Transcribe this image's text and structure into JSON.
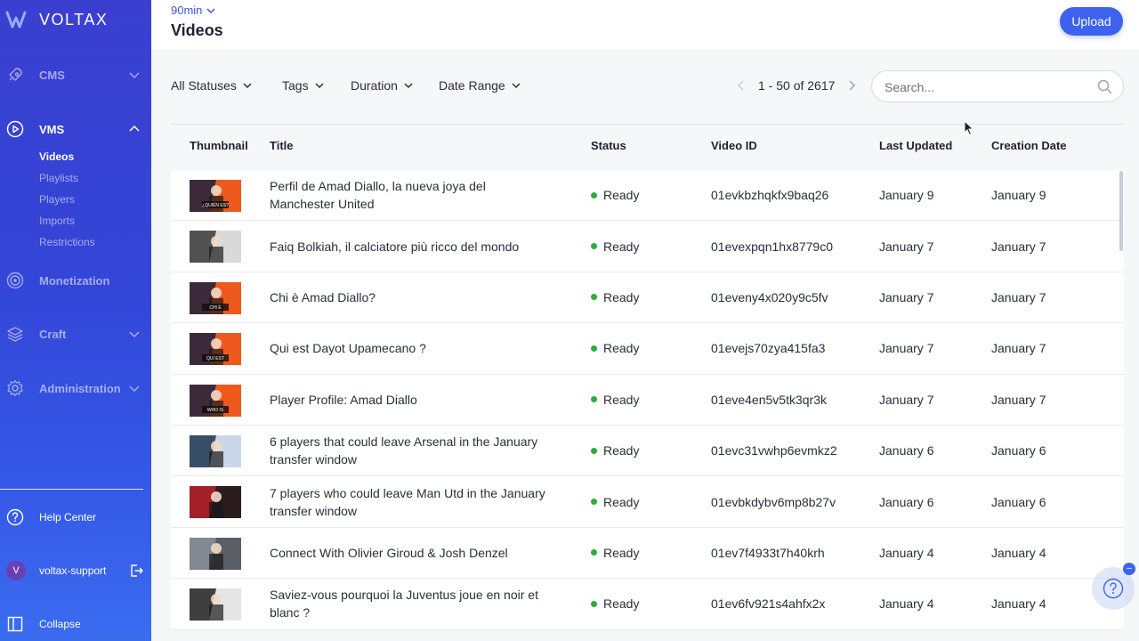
{
  "brand": {
    "name": "VOLTAX"
  },
  "sidebar": {
    "nav": [
      {
        "label": "CMS",
        "icon": "rocket-icon"
      },
      {
        "label": "VMS",
        "icon": "play-circle-icon"
      },
      {
        "label": "Monetization",
        "icon": "target-icon"
      },
      {
        "label": "Craft",
        "icon": "layers-icon"
      },
      {
        "label": "Administration",
        "icon": "gear-icon"
      }
    ],
    "vms_items": [
      "Videos",
      "Playlists",
      "Players",
      "Imports",
      "Restrictions"
    ],
    "help_center": "Help Center",
    "user": {
      "initial": "V",
      "name": "voltax-support"
    },
    "collapse": "Collapse"
  },
  "header": {
    "org": "90min",
    "title": "Videos",
    "upload_label": "Upload"
  },
  "filters": {
    "statuses": "All Statuses",
    "tags": "Tags",
    "duration": "Duration",
    "date_range": "Date Range"
  },
  "pager": {
    "text": "1 - 50 of 2617"
  },
  "search": {
    "placeholder": "Search..."
  },
  "table": {
    "headers": {
      "thumbnail": "Thumbnail",
      "title": "Title",
      "status": "Status",
      "video_id": "Video ID",
      "last_updated": "Last Updated",
      "creation_date": "Creation Date"
    },
    "rows": [
      {
        "title": "Perfil de Amad Diallo, la nueva joya del Manchester United",
        "status": "Ready",
        "video_id": "01evkbzhqkfx9baq26",
        "last_updated": "January 9",
        "created": "January 9",
        "thumb_text": "¿QUIÉN ES?"
      },
      {
        "title": "Faiq Bolkiah, il calciatore più ricco del mondo",
        "status": "Ready",
        "video_id": "01evexpqn1hx8779c0",
        "last_updated": "January 7",
        "created": "January 7",
        "thumb_text": ""
      },
      {
        "title": "Chi è Amad Diallo?",
        "status": "Ready",
        "video_id": "01eveny4x020y9c5fv",
        "last_updated": "January 7",
        "created": "January 7",
        "thumb_text": "CHI È"
      },
      {
        "title": "Qui est Dayot Upamecano ?",
        "status": "Ready",
        "video_id": "01evejs70zya415fa3",
        "last_updated": "January 7",
        "created": "January 7",
        "thumb_text": "QUI EST"
      },
      {
        "title": "Player Profile: Amad Diallo",
        "status": "Ready",
        "video_id": "01eve4en5v5tk3qr3k",
        "last_updated": "January 7",
        "created": "January 7",
        "thumb_text": "WHO IS"
      },
      {
        "title": "6 players that could leave Arsenal in the January transfer window",
        "status": "Ready",
        "video_id": "01evc31vwhp6evmkz2",
        "last_updated": "January 6",
        "created": "January 6",
        "thumb_text": ""
      },
      {
        "title": "7 players who could leave Man Utd in the January transfer window",
        "status": "Ready",
        "video_id": "01evbkdybv6mp8b27v",
        "last_updated": "January 6",
        "created": "January 6",
        "thumb_text": ""
      },
      {
        "title": "Connect With Olivier Giroud & Josh Denzel",
        "status": "Ready",
        "video_id": "01ev7f4933t7h40krh",
        "last_updated": "January 4",
        "created": "January 4",
        "thumb_text": ""
      },
      {
        "title": "Saviez-vous pourquoi la Juventus joue en noir et blanc ?",
        "status": "Ready",
        "video_id": "01ev6fv921s4ahfx2x",
        "last_updated": "January 4",
        "created": "January 4",
        "thumb_text": ""
      }
    ]
  },
  "colors": {
    "accent": "#3d63ee",
    "status_ready": "#2eaa3f",
    "thumb_orange": "#ee5a1e"
  }
}
